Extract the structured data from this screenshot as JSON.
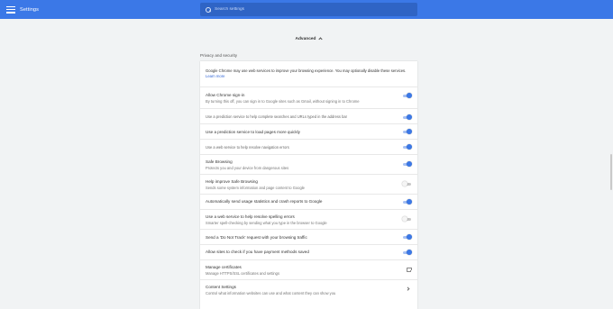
{
  "toolbar": {
    "menu_icon": "hamburger-menu-icon",
    "title": "Settings",
    "search_placeholder": "Search settings",
    "search_value": "",
    "accent_color": "#3b78e7"
  },
  "advanced": {
    "label": "Advanced",
    "icon": "chevron-up-icon"
  },
  "section": {
    "title": "Privacy and security"
  },
  "privacy": {
    "intro_text": "Google Chrome may use web services to improve your browsing experience. You may optionally disable these services.",
    "learn_more": "Learn more",
    "rows": [
      {
        "primary": "Allow Chrome sign-in",
        "secondary": "By turning this off, you can sign in to Google sites such as Gmail, without signing in to Chrome",
        "control": "toggle",
        "state": "on"
      },
      {
        "primary": "Use a prediction service to help complete searches and URLs typed in the address bar",
        "secondary": "",
        "control": "toggle",
        "state": "on"
      },
      {
        "primary": "Use a prediction service to load pages more quickly",
        "secondary": "",
        "control": "toggle",
        "state": "on"
      },
      {
        "primary": "Use a web service to help resolve navigation errors",
        "secondary": "",
        "control": "toggle",
        "state": "on"
      },
      {
        "primary": "Safe Browsing",
        "secondary": "Protects you and your device from dangerous sites",
        "control": "toggle",
        "state": "on"
      },
      {
        "primary": "Help improve Safe Browsing",
        "secondary": "Sends some system information and page content to Google",
        "control": "toggle",
        "state": "off"
      },
      {
        "primary": "Automatically send usage statistics and crash reports to Google",
        "secondary": "",
        "control": "toggle",
        "state": "on"
      },
      {
        "primary": "Use a web service to help resolve spelling errors",
        "secondary": "Smarter spell-checking by sending what you type in the browser to Google",
        "control": "toggle",
        "state": "off"
      },
      {
        "primary": "Send a 'Do Not Track' request with your browsing traffic",
        "secondary": "",
        "control": "toggle",
        "state": "on"
      },
      {
        "primary": "Allow sites to check if you have payment methods saved",
        "secondary": "",
        "control": "toggle",
        "state": "on"
      },
      {
        "primary": "Manage certificates",
        "secondary": "Manage HTTPS/SSL certificates and settings",
        "control": "external-link",
        "state": ""
      },
      {
        "primary": "Content Settings",
        "secondary": "Control what information websites can use and what content they can show you",
        "control": "arrow",
        "state": ""
      }
    ]
  }
}
